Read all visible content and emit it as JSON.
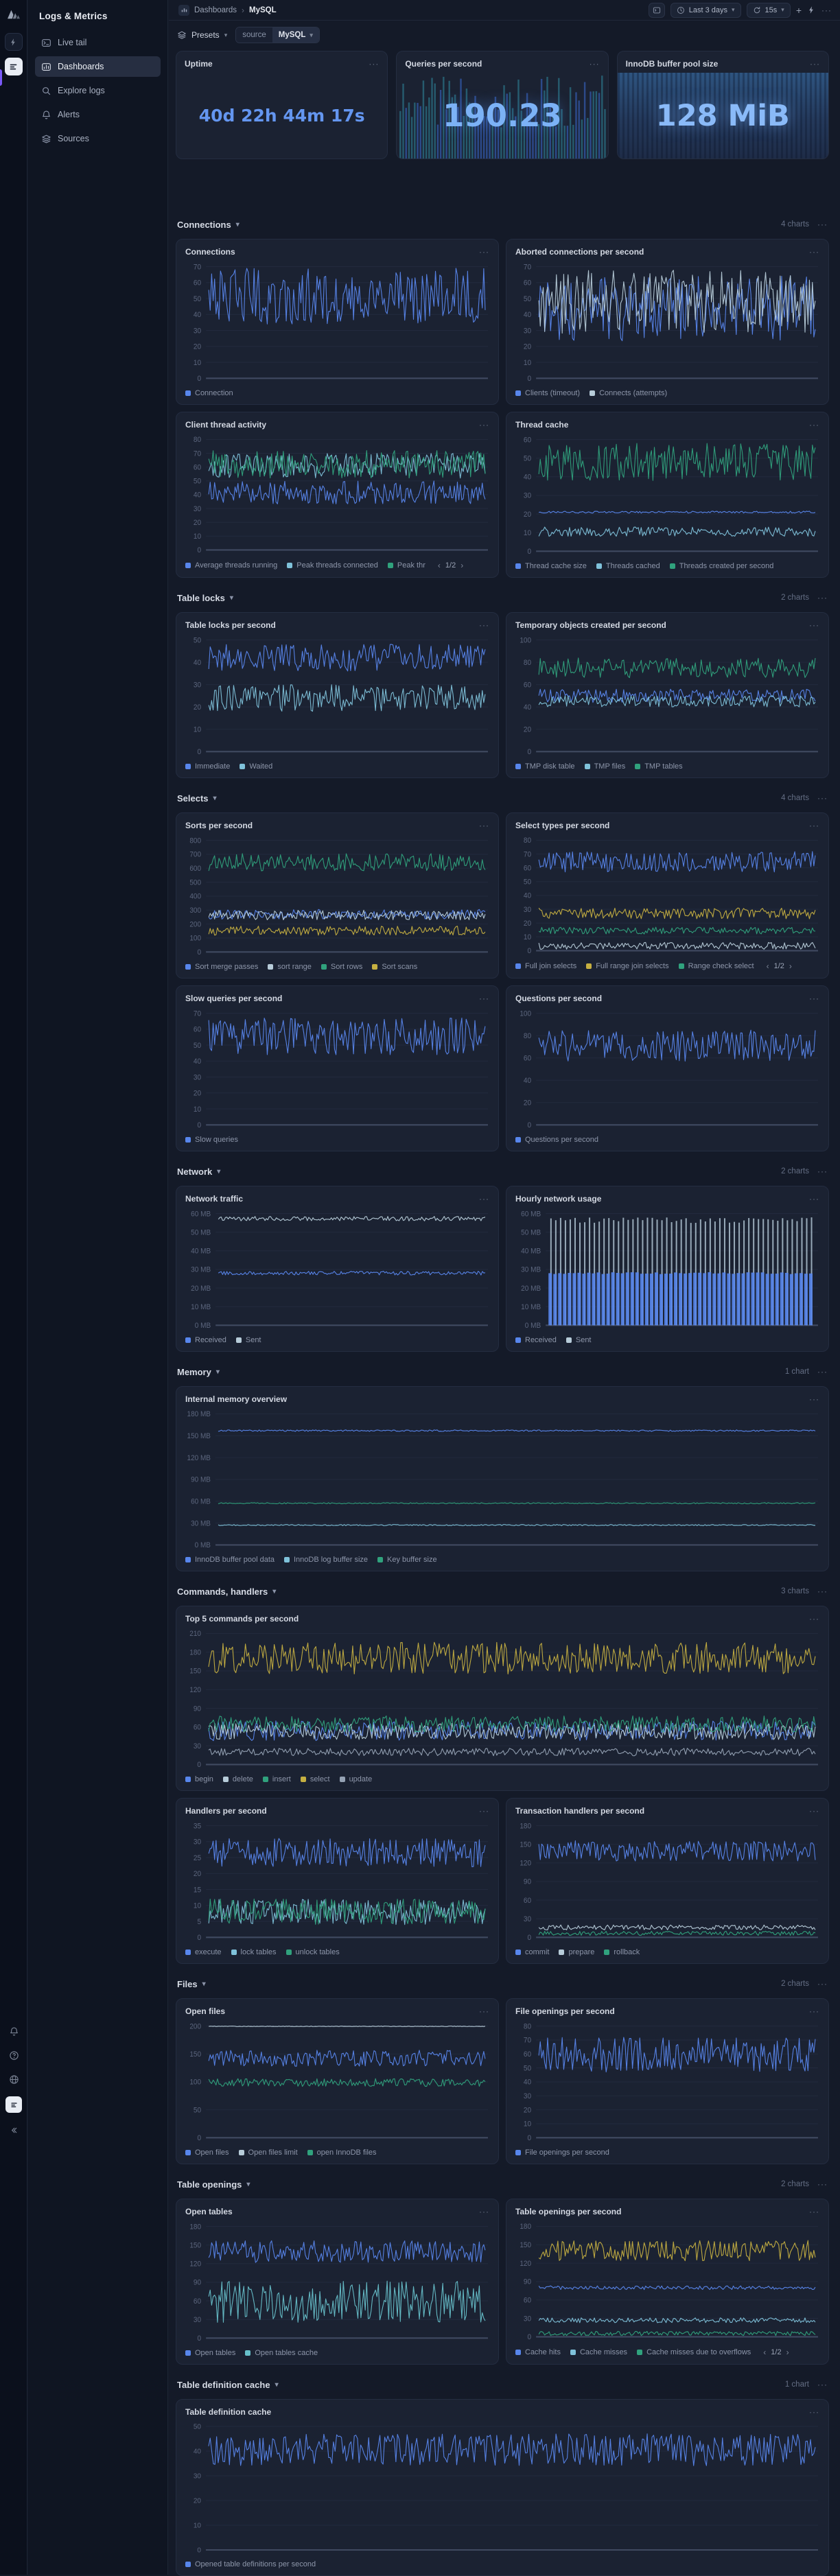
{
  "app": {
    "title": "Logs & Metrics"
  },
  "icons": {
    "ellipsis": "···",
    "chevron_down": "▾",
    "breadcrumb_sep": "›",
    "chevron_left": "‹",
    "chevron_right": "›",
    "plus": "+"
  },
  "topbar": {
    "breadcrumb_root": "Dashboards",
    "breadcrumb_current": "MySQL",
    "time_range_label": "Last 3 days",
    "refresh_label": "15s"
  },
  "sidebar": {
    "items": [
      {
        "label": "Live tail",
        "icon": "terminal",
        "active": false
      },
      {
        "label": "Dashboards",
        "icon": "chart",
        "active": true
      },
      {
        "label": "Explore logs",
        "icon": "search",
        "active": false
      },
      {
        "label": "Alerts",
        "icon": "bell",
        "active": false
      },
      {
        "label": "Sources",
        "icon": "stack",
        "active": false
      }
    ]
  },
  "filters": {
    "presets_label": "Presets",
    "source_key": "source",
    "source_value": "MySQL"
  },
  "stats": [
    {
      "title": "Uptime",
      "value": "40d 22h 44m 17s",
      "style": "plain"
    },
    {
      "title": "Queries per second",
      "value": "190.23",
      "style": "sparkline"
    },
    {
      "title": "InnoDB buffer pool size",
      "value": "128 MiB",
      "style": "filled"
    }
  ],
  "palette": {
    "blue": "#5886ec",
    "pale": "#b7ccd9",
    "lightblue": "#7fc2da",
    "green": "#30a27d",
    "yellow": "#c6b041",
    "gray": "#95a2b4",
    "teal": "#67c0ca"
  },
  "chart_data": {
    "note": "see sections[].charts[] — each chart lists type, y-axis ticks, units and per-series value ranges read from the pixels"
  },
  "sections": [
    {
      "title": "Connections",
      "count": "4 charts",
      "charts": [
        {
          "title": "Connections",
          "span": "half",
          "type": "line",
          "y_ticks": [
            70,
            60,
            50,
            40,
            30,
            20,
            10,
            0
          ],
          "series": [
            {
              "name": "Connection",
              "color": "blue",
              "range": [
                34,
                69
              ]
            }
          ]
        },
        {
          "title": "Aborted connections per second",
          "span": "half",
          "type": "line",
          "y_ticks": [
            70,
            60,
            50,
            40,
            30,
            20,
            10,
            0
          ],
          "series": [
            {
              "name": "Clients (timeout)",
              "color": "blue",
              "range": [
                23,
                64
              ]
            },
            {
              "name": "Connects (attempts)",
              "color": "pale",
              "range": [
                28,
                68
              ]
            }
          ]
        },
        {
          "title": "Client thread activity",
          "span": "half",
          "type": "line",
          "y_ticks": [
            80,
            70,
            60,
            50,
            40,
            30,
            20,
            10,
            0
          ],
          "legend_overflow": "1/2",
          "series": [
            {
              "name": "Average threads running",
              "color": "blue",
              "range": [
                33,
                50
              ]
            },
            {
              "name": "Peak threads connected",
              "color": "lightblue",
              "range": [
                52,
                70
              ]
            },
            {
              "name": "Peak thr",
              "color": "green",
              "range": [
                52,
                72
              ]
            }
          ]
        },
        {
          "title": "Thread cache",
          "span": "half",
          "type": "line",
          "y_ticks": [
            60,
            50,
            40,
            30,
            20,
            10,
            0
          ],
          "series": [
            {
              "name": "Thread cache size",
              "color": "blue",
              "range": [
                20.5,
                21.5
              ]
            },
            {
              "name": "Threads cached",
              "color": "lightblue",
              "range": [
                8,
                13
              ]
            },
            {
              "name": "Threads created per second",
              "color": "green",
              "range": [
                38,
                58
              ]
            }
          ]
        }
      ]
    },
    {
      "title": "Table locks",
      "count": "2 charts",
      "charts": [
        {
          "title": "Table locks per second",
          "span": "half",
          "type": "line",
          "y_ticks": [
            50,
            40,
            30,
            20,
            10,
            0
          ],
          "series": [
            {
              "name": "Immediate",
              "color": "blue",
              "range": [
                36,
                48
              ]
            },
            {
              "name": "Waited",
              "color": "lightblue",
              "range": [
                18,
                30
              ]
            }
          ]
        },
        {
          "title": "Temporary objects created per second",
          "span": "half",
          "type": "line",
          "y_ticks": [
            100,
            80,
            60,
            40,
            20,
            0
          ],
          "series": [
            {
              "name": "TMP disk table",
              "color": "blue",
              "range": [
                44,
                56
              ]
            },
            {
              "name": "TMP files",
              "color": "lightblue",
              "range": [
                40,
                50
              ]
            },
            {
              "name": "TMP tables",
              "color": "green",
              "range": [
                66,
                84
              ]
            }
          ]
        }
      ]
    },
    {
      "title": "Selects",
      "count": "4 charts",
      "charts": [
        {
          "title": "Sorts per second",
          "span": "half",
          "type": "line",
          "y_ticks": [
            800,
            700,
            600,
            500,
            400,
            300,
            200,
            100,
            0
          ],
          "series": [
            {
              "name": "Sort merge passes",
              "color": "blue",
              "range": [
                235,
                305
              ]
            },
            {
              "name": "sort range",
              "color": "pale",
              "range": [
                230,
                300
              ]
            },
            {
              "name": "Sort rows",
              "color": "green",
              "range": [
                580,
                705
              ]
            },
            {
              "name": "Sort scans",
              "color": "yellow",
              "range": [
                120,
                185
              ]
            }
          ]
        },
        {
          "title": "Select types per second",
          "span": "half",
          "type": "line",
          "y_ticks": [
            80,
            70,
            60,
            50,
            40,
            30,
            20,
            10,
            0
          ],
          "legend_overflow": "1/2",
          "legend_limit": 3,
          "series": [
            {
              "name": "Full join selects",
              "color": "blue",
              "range": [
                57,
                72
              ]
            },
            {
              "name": "Full range join selects",
              "color": "yellow",
              "range": [
                23,
                31
              ]
            },
            {
              "name": "Range check select",
              "color": "green",
              "range": [
                12,
                17
              ]
            },
            {
              "name": "",
              "color": "pale",
              "range": [
                1,
                6
              ]
            }
          ]
        },
        {
          "title": "Slow queries per second",
          "span": "half",
          "type": "line",
          "y_ticks": [
            70,
            60,
            50,
            40,
            30,
            20,
            10,
            0
          ],
          "series": [
            {
              "name": "Slow queries",
              "color": "blue",
              "range": [
                44,
                67
              ]
            }
          ]
        },
        {
          "title": "Questions per second",
          "span": "half",
          "type": "line",
          "y_ticks": [
            100,
            80,
            60,
            40,
            20,
            0
          ],
          "series": [
            {
              "name": "Questions per second",
              "color": "blue",
              "range": [
                57,
                85
              ]
            }
          ]
        }
      ]
    },
    {
      "title": "Network",
      "count": "2 charts",
      "charts": [
        {
          "title": "Network traffic",
          "span": "half",
          "type": "line",
          "unit": " MB",
          "y_ticks": [
            60,
            50,
            40,
            30,
            20,
            10,
            0
          ],
          "series": [
            {
              "name": "Received",
              "color": "blue",
              "range": [
                27,
                29
              ]
            },
            {
              "name": "Sent",
              "color": "pale",
              "range": [
                56,
                58.5
              ]
            }
          ]
        },
        {
          "title": "Hourly network usage",
          "span": "half",
          "type": "bars",
          "unit": " MB",
          "y_ticks": [
            60,
            50,
            40,
            30,
            20,
            10,
            0
          ],
          "series": [
            {
              "name": "Received",
              "color": "blue",
              "range": [
                27.5,
                28.5
              ]
            },
            {
              "name": "Sent",
              "color": "pale",
              "range": [
                55,
                58
              ]
            }
          ]
        }
      ]
    },
    {
      "title": "Memory",
      "count": "1 chart",
      "charts": [
        {
          "title": "Internal memory overview",
          "span": "full",
          "type": "line",
          "unit": " MB",
          "y_ticks": [
            180,
            150,
            120,
            90,
            60,
            30,
            0
          ],
          "series": [
            {
              "name": "InnoDB buffer pool data",
              "color": "blue",
              "range": [
                156,
                158
              ]
            },
            {
              "name": "InnoDB log buffer size",
              "color": "lightblue",
              "range": [
                26.5,
                28
              ]
            },
            {
              "name": "Key buffer size",
              "color": "green",
              "range": [
                56.5,
                58
              ]
            }
          ]
        }
      ]
    },
    {
      "title": "Commands, handlers",
      "count": "3 charts",
      "charts": [
        {
          "title": "Top 5 commands per second",
          "span": "full",
          "type": "line",
          "y_ticks": [
            210,
            180,
            150,
            120,
            90,
            60,
            30,
            0
          ],
          "series": [
            {
              "name": "begin",
              "color": "blue",
              "range": [
                38,
                70
              ]
            },
            {
              "name": "delete",
              "color": "pale",
              "range": [
                40,
                66
              ]
            },
            {
              "name": "insert",
              "color": "green",
              "range": [
                52,
                78
              ]
            },
            {
              "name": "select",
              "color": "yellow",
              "range": [
                145,
                196
              ]
            },
            {
              "name": "update",
              "color": "gray",
              "range": [
                14,
                26
              ]
            }
          ]
        },
        {
          "title": "Handlers per second",
          "span": "half",
          "type": "line",
          "y_ticks": [
            35,
            30,
            25,
            20,
            15,
            10,
            5,
            0
          ],
          "series": [
            {
              "name": "execute",
              "color": "blue",
              "range": [
                22,
                31
              ]
            },
            {
              "name": "lock tables",
              "color": "lightblue",
              "range": [
                4,
                12
              ]
            },
            {
              "name": "unlock tables",
              "color": "green",
              "range": [
                4,
                12
              ]
            }
          ]
        },
        {
          "title": "Transaction handlers per second",
          "span": "half",
          "type": "line",
          "y_ticks": [
            180,
            150,
            120,
            90,
            60,
            30,
            0
          ],
          "series": [
            {
              "name": "commit",
              "color": "blue",
              "range": [
                123,
                156
              ]
            },
            {
              "name": "prepare",
              "color": "pale",
              "range": [
                12,
                20
              ]
            },
            {
              "name": "rollback",
              "color": "green",
              "range": [
                3,
                10
              ]
            }
          ]
        }
      ]
    },
    {
      "title": "Files",
      "count": "2 charts",
      "charts": [
        {
          "title": "Open files",
          "span": "half",
          "type": "line",
          "y_ticks": [
            200,
            150,
            100,
            50,
            0
          ],
          "series": [
            {
              "name": "Open files",
              "color": "blue",
              "range": [
                128,
                157
              ]
            },
            {
              "name": "Open files limit",
              "color": "pale",
              "range": [
                199,
                200
              ]
            },
            {
              "name": "open InnoDB files",
              "color": "green",
              "range": [
                92,
                106
              ]
            }
          ]
        },
        {
          "title": "File openings per second",
          "span": "half",
          "type": "line",
          "y_ticks": [
            80,
            70,
            60,
            50,
            40,
            30,
            20,
            10,
            0
          ],
          "series": [
            {
              "name": "File openings per second",
              "color": "blue",
              "range": [
                47,
                72
              ]
            }
          ]
        }
      ]
    },
    {
      "title": "Table openings",
      "count": "2 charts",
      "charts": [
        {
          "title": "Open tables",
          "span": "half",
          "type": "line",
          "y_ticks": [
            180,
            150,
            120,
            90,
            60,
            30,
            0
          ],
          "series": [
            {
              "name": "Open tables",
              "color": "blue",
              "range": [
                122,
                157
              ]
            },
            {
              "name": "Open tables cache",
              "color": "teal",
              "range": [
                25,
                92
              ]
            }
          ]
        },
        {
          "title": "Table openings per second",
          "span": "half",
          "type": "line",
          "y_ticks": [
            180,
            150,
            120,
            90,
            60,
            30,
            0
          ],
          "legend_overflow": "1/2",
          "legend_limit": 3,
          "series": [
            {
              "name": "Cache hits",
              "color": "blue",
              "range": [
                77,
                83
              ]
            },
            {
              "name": "Cache misses",
              "color": "lightblue",
              "range": [
                23,
                31
              ]
            },
            {
              "name": "Cache misses due to overflows",
              "color": "green",
              "range": [
                2,
                9
              ]
            },
            {
              "name": "",
              "color": "yellow",
              "range": [
                124,
                158
              ]
            }
          ]
        }
      ]
    },
    {
      "title": "Table definition cache",
      "count": "1 chart",
      "charts": [
        {
          "title": "Table definition cache",
          "span": "full",
          "type": "line",
          "y_ticks": [
            50,
            40,
            30,
            20,
            10,
            0
          ],
          "series": [
            {
              "name": "Opened table definitions per second",
              "color": "blue",
              "range": [
                34,
                47
              ]
            }
          ]
        }
      ]
    }
  ]
}
